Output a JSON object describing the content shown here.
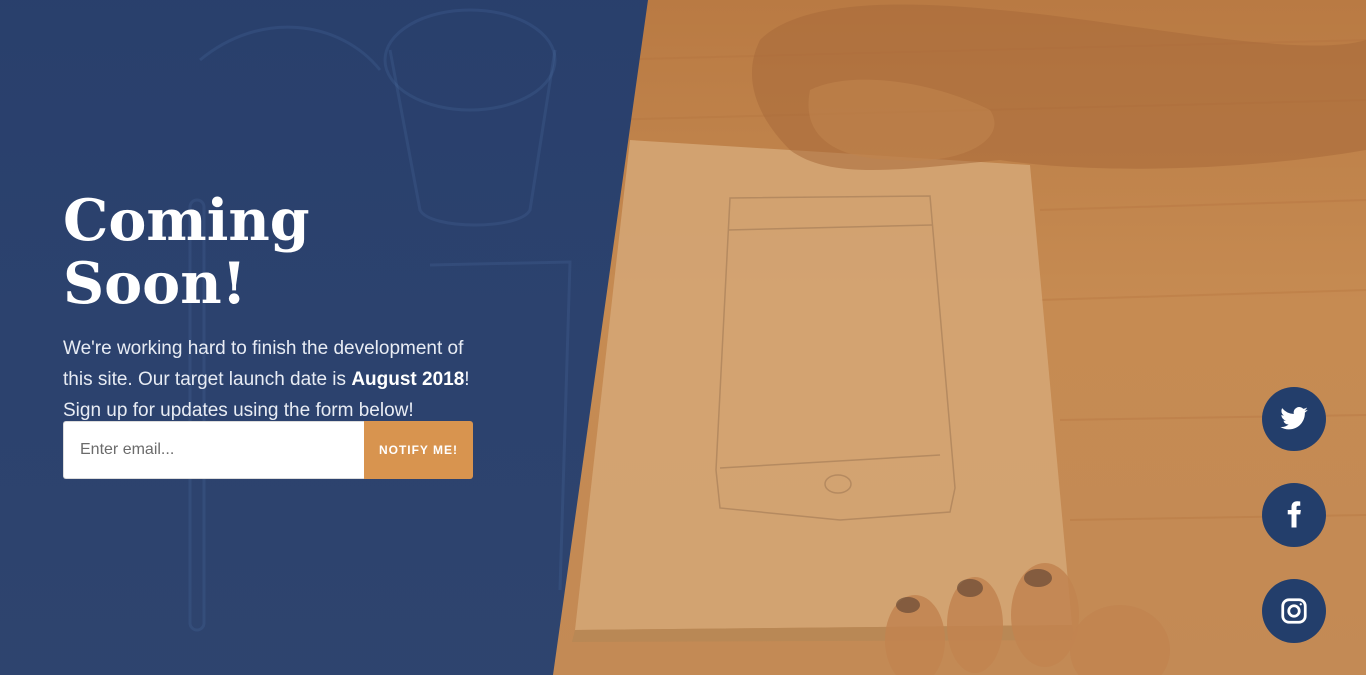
{
  "hero": {
    "title": "Coming Soon!",
    "description_before": "We're working hard to finish the development of this site. Our target launch date is ",
    "launch_date": "August 2018",
    "description_after": "! Sign up for updates using the form below!"
  },
  "signup": {
    "email_placeholder": "Enter email...",
    "email_value": "",
    "button_label": "NOTIFY ME!"
  },
  "social": [
    {
      "icon": "twitter-icon"
    },
    {
      "icon": "facebook-icon"
    },
    {
      "icon": "instagram-icon"
    }
  ],
  "colors": {
    "panel_blue": "#233e6b",
    "accent_orange": "#d8944f",
    "background_orange": "#c68b52"
  }
}
